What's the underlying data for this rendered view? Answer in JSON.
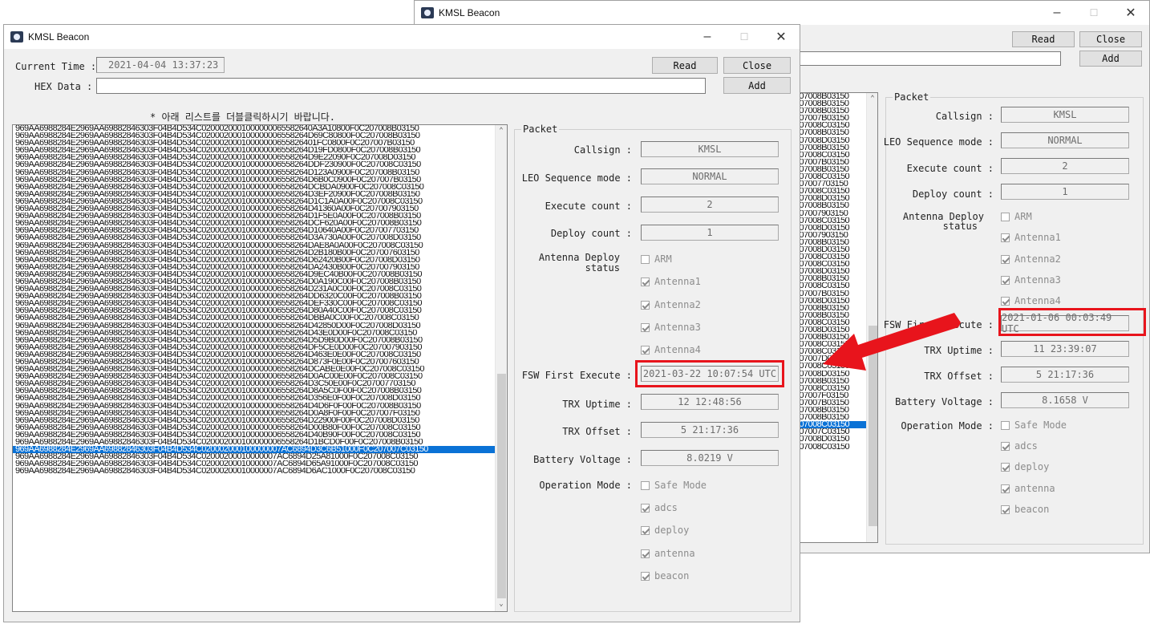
{
  "back_window": {
    "title": "KMSL Beacon",
    "read_label": "Read",
    "close_label": "Close",
    "add_label": "Add",
    "list_rows": [
      "207008B03150",
      "207008B03150",
      "207008B03150",
      "207007B03150",
      "207008C03150",
      "207008B03150",
      "207008D03150",
      "207008B03150",
      "207008C03150",
      "207007B03150",
      "207008B03150",
      "207008C03150",
      "207007703150",
      "207008C03150",
      "207008D03150",
      "207008B03150",
      "207007903150",
      "207008C03150",
      "207008D03150",
      "207007903150",
      "207008B03150",
      "207008D03150",
      "207008C03150",
      "207008C03150",
      "207008D03150",
      "207008B03150",
      "207008C03150",
      "207007B03150",
      "207008D03150",
      "207008B03150",
      "207008B03150",
      "207008C03150",
      "207008D03150",
      "207008B03150",
      "207008C03150",
      "207008C03150",
      "207007D03150",
      "207008C03150",
      "207008D03150",
      "207008B03150",
      "207008C03150",
      "207007F03150",
      "207007B03150",
      "207008B03150",
      "207008B03150",
      "207008C03150",
      "207007C03150",
      "207008D03150",
      "207008C03150"
    ],
    "selected_index": 45,
    "packet": {
      "group_title": "Packet",
      "callsign_label": "Callsign :",
      "callsign_value": "KMSL",
      "leo_label": "LEO Sequence mode :",
      "leo_value": "NORMAL",
      "exec_label": "Execute count :",
      "exec_value": "2",
      "deploy_label": "Deploy count :",
      "deploy_value": "1",
      "antenna_label_1": "Antenna Deploy",
      "antenna_label_2": "status",
      "arm_label": "ARM",
      "antenna1": "Antenna1",
      "antenna2": "Antenna2",
      "antenna3": "Antenna3",
      "antenna4": "Antenna4",
      "fsw_label": "FSW First Execute :",
      "fsw_value": "2021-01-06 00:03:49 UTC",
      "trx_uptime_label": "TRX Uptime :",
      "trx_uptime_value": "11 23:39:07",
      "trx_offset_label": "TRX Offset :",
      "trx_offset_value": "5 21:17:36",
      "battery_label": "Battery Voltage :",
      "battery_value": "8.1658 V",
      "op_mode_label": "Operation Mode :",
      "safe_mode": "Safe Mode",
      "adcs": "adcs",
      "deploy": "deploy",
      "antenna": "antenna",
      "beacon": "beacon"
    }
  },
  "front_window": {
    "title": "KMSL Beacon",
    "current_time_label": "Current Time :",
    "current_time_value": "2021-04-04 13:37:23",
    "hex_data_label": "HEX Data :",
    "hex_data_value": "",
    "read_label": "Read",
    "close_label": "Close",
    "add_label": "Add",
    "list_hint": "* 아래 리스트를 더블클릭하시기 바랍니다.",
    "list_rows": [
      "969AA6988284E2969AA69882846303F04B4D534C0200020001000000065582640A3A10800F0C207008B03150",
      "969AA6988284E2969AA69882846303F04B4D534C020002000100000006558264D69C80800F0C207008B03150",
      "969AA6988284E2969AA69882846303F04B4D534C02000200010000000655826401FC0800F0C207007B03150",
      "969AA6988284E2969AA69882846303F04B4D534C020002000100000006558264D19FD0800F0C207008B03150",
      "969AA6988284E2969AA69882846303F04B4D534C020002000100000006558264D9E22090F0C207008D03150",
      "969AA6988284E2969AA69882846303F04B4D534C020002000100000006558264DDF230900F0C207008C03150",
      "969AA6988284E2969AA69882846303F04B4D534C020002000100000006558264D123A0900F0C207008B03150",
      "969AA6988284E2969AA69882846303F04B4D534C020002000100000006558264D6B0C0900F0C207007B03150",
      "969AA6988284E2969AA69882846303F04B4D534C020002000100000006558264DCBDA0900F0C207008C03150",
      "969AA6988284E2969AA69882846303F04B4D534C020002000100000006558264D3EF20900F0C207008B03150",
      "969AA6988284E2969AA69882846303F04B4D534C020002000100000006558264D1C1A0A00F0C207008C03150",
      "969AA6988284E2969AA69882846303F04B4D534C020002000100000006558264D41360A00F0C207007903150",
      "969AA6988284E2969AA69882846303F04B4D534C020002000100000006558264D1F5E0A00F0C207008B03150",
      "969AA6988284E2969AA69882846303F04B4D534C020002000100000006558264DCF620A00F0C207008B03150",
      "969AA6988284E2969AA69882846303F04B4D534C020002000100000006558264D10640A00F0C207007703150",
      "969AA6988284E2969AA69882846303F04B4D534C020002000100000006558264D3A730A00F0C207008D03150",
      "969AA6988284E2969AA69882846303F04B4D534C020002000100000006558264DAE8A0A00F0C207008C03150",
      "969AA6988284E2969AA69882846303F04B4D534C020002000100000006558264D2B180B00F0C207007603150",
      "969AA6988284E2969AA69882846303F04B4D534C020002000100000006558264D62420B00F0C207008D03150",
      "969AA6988284E2969AA69882846303F04B4D534C020002000100000006558264DA2430B00F0C207007903150",
      "969AA6988284E2969AA69882846303F04B4D534C020002000100000006558264D9EC40B00F0C207008B03150",
      "969AA6988284E2969AA69882846303F04B4D534C020002000100000006558264D0A190C00F0C207008B03150",
      "969AA6988284E2969AA69882846303F04B4D534C020002000100000006558264D231A0C00F0C207008C03150",
      "969AA6988284E2969AA69882846303F04B4D534C020002000100000006558264DD6320C00F0C207008B03150",
      "969AA6988284E2969AA69882846303F04B4D534C020002000100000006558264DEF330C00F0C207008C03150",
      "969AA6988284E2969AA69882846303F04B4D534C020002000100000006558264D80A40C00F0C207008C03150",
      "969AA6988284E2969AA69882846303F04B4D534C020002000100000006558264DBBA0C00F0C207008C03150",
      "969AA6988284E2969AA69882846303F04B4D534C020002000100000006558264D42850D00F0C207008D03150",
      "969AA6988284E2969AA69882846303F04B4D534C020002000100000006558264D43E0D00F0C207008C03150",
      "969AA6988284E2969AA69882846303F04B4D534C020002000100000006558264D5D9B0D00F0C207008B03150",
      "969AA6988284E2969AA69882846303F04B4D534C020002000100000006558264DF5CE0D00F0C207007903150",
      "969AA6988284E2969AA69882846303F04B4D534C020002000100000006558264D463E0E00F0C207008C03150",
      "969AA6988284E2969AA69882846303F04B4D534C020002000100000006558264D873F0E00F0C207007603150",
      "969AA6988284E2969AA69882846303F04B4D534C020002000100000006558264DCABE0E00F0C207008C03150",
      "969AA6988284E2969AA69882846303F04B4D534C020002000100000006558264D0AC00E00F0C207008C03150",
      "969AA6988284E2969AA69882846303F04B4D534C020002000100000006558264D3C50E00F0C207007703150",
      "969AA6988284E2969AA69882846303F04B4D534C020002000100000006558264D8A5C0F00F0C207008B03150",
      "969AA6988284E2969AA69882846303F04B4D534C020002000100000006558264D356E0F00F0C207008D03150",
      "969AA6988284E2969AA69882846303F04B4D534C020002000100000006558264D4D6F0F00F0C207008B03150",
      "969AA6988284E2969AA69882846303F04B4D534C020002000100000006558264D0A8F0F00F0C207007F03150",
      "969AA6988284E2969AA69882846303F04B4D534C020002000100000006558264D22900F00F0C207008D03150",
      "969AA6988284E2969AA69882846303F04B4D534C020002000100000006558264D00B80F00F0C207008C03150",
      "969AA6988284E2969AA69882846303F04B4D534C020002000100000006558264D40B90F00F0C207008C03150",
      "969AA6988284E2969AA69882846303F04B4D534C020002000100000006558264D1BCD0F00F0C207008B03150",
      "969AA6988284E2969AA69882846303F04B4D534C020002000100000007AC6894D3C6B51000F0C207007C03150",
      "969AA6988284E2969AA69882846303F04B4D534C02000200010000007AC6894D25A81000F0C207008C03150",
      "969AA6988284E2969AA69882846303F04B4D534C02000200010000007AC6894D65A91000F0C207008C03150",
      "969AA6988284E2969AA69882846303F04B4D534C02000200010000007AC6894D6AC1000F0C207008C03150"
    ],
    "selected_index": 44,
    "packet": {
      "group_title": "Packet",
      "callsign_label": "Callsign :",
      "callsign_value": "KMSL",
      "leo_label": "LEO Sequence mode :",
      "leo_value": "NORMAL",
      "exec_label": "Execute count :",
      "exec_value": "2",
      "deploy_label": "Deploy count :",
      "deploy_value": "1",
      "antenna_label_1": "Antenna Deploy",
      "antenna_label_2": "status",
      "arm_label": "ARM",
      "antenna1": "Antenna1",
      "antenna2": "Antenna2",
      "antenna3": "Antenna3",
      "antenna4": "Antenna4",
      "fsw_label": "FSW First Execute :",
      "fsw_value": "2021-03-22 10:07:54 UTC",
      "trx_uptime_label": "TRX Uptime :",
      "trx_uptime_value": "12 12:48:56",
      "trx_offset_label": "TRX Offset :",
      "trx_offset_value": "5 21:17:36",
      "battery_label": "Battery Voltage :",
      "battery_value": "8.0219 V",
      "op_mode_label": "Operation Mode :",
      "safe_mode": "Safe Mode",
      "adcs": "adcs",
      "deploy": "deploy",
      "antenna": "antenna",
      "beacon": "beacon"
    }
  },
  "colors": {
    "highlight": "#e8141c",
    "selection": "#0a72d6"
  }
}
